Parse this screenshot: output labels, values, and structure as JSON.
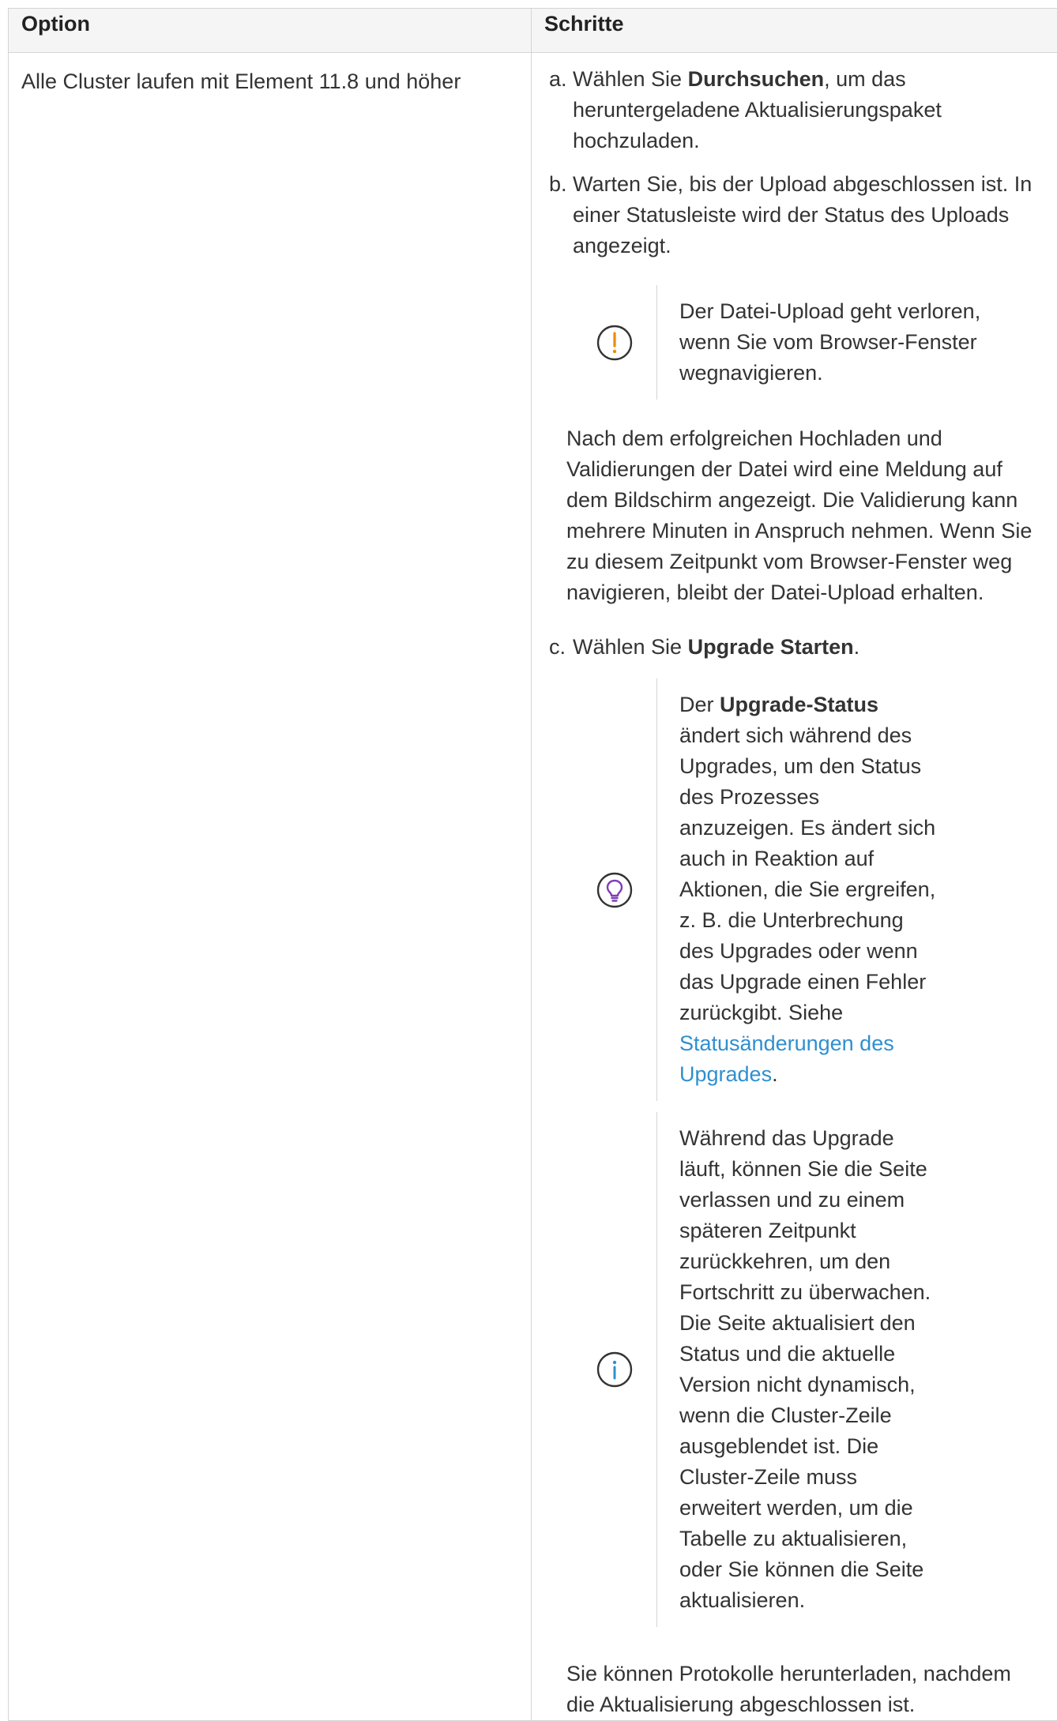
{
  "table": {
    "header": {
      "option": "Option",
      "steps": "Schritte"
    },
    "row": {
      "option": "Alle Cluster laufen mit Element 11.8 und höher",
      "step_a": {
        "marker": "a.",
        "pre": "Wählen Sie ",
        "bold": "Durchsuchen",
        "post": ", um das heruntergeladene Aktualisierungspaket hochzuladen."
      },
      "step_b": {
        "marker": "b.",
        "text": "Warten Sie, bis der Upload abgeschlossen ist. In einer Statusleiste wird der Status des Uploads angezeigt."
      },
      "warning": {
        "icon": "warning-icon",
        "color": "#f08a00",
        "text": "Der Datei-Upload geht verloren, wenn Sie vom Browser-Fenster wegnavigieren."
      },
      "para_after_upload": "Nach dem erfolgreichen Hochladen und Validierungen der Datei wird eine Meldung auf dem Bildschirm angezeigt. Die Validierung kann mehrere Minuten in Anspruch nehmen. Wenn Sie zu diesem Zeitpunkt vom Browser-Fenster weg navigieren, bleibt der Datei-Upload erhalten.",
      "step_c": {
        "marker": "c.",
        "pre": "Wählen Sie ",
        "bold": "Upgrade Starten",
        "post": "."
      },
      "tip": {
        "icon": "lightbulb-icon",
        "color": "#7e3fb8",
        "pre": "Der ",
        "bold": "Upgrade-Status",
        "mid": " ändert sich während des Upgrades, um den Status des Prozesses anzuzeigen. Es ändert sich auch in Reaktion auf Aktionen, die Sie ergreifen, z. B. die Unterbrechung des Upgrades oder wenn das Upgrade einen Fehler zurückgibt. Siehe ",
        "link": "Statusänderungen des Upgrades",
        "post": "."
      },
      "info": {
        "icon": "info-icon",
        "color": "#2f8fd0",
        "text": "Während das Upgrade läuft, können Sie die Seite verlassen und zu einem späteren Zeitpunkt zurückkehren, um den Fortschritt zu überwachen. Die Seite aktualisiert den Status und die aktuelle Version nicht dynamisch, wenn die Cluster-Zeile ausgeblendet ist. Die Cluster-Zeile muss erweitert werden, um die Tabelle zu aktualisieren, oder Sie können die Seite aktualisieren."
      },
      "para_logs": "Sie können Protokolle herunterladen, nachdem die Aktualisierung abgeschlossen ist."
    }
  }
}
